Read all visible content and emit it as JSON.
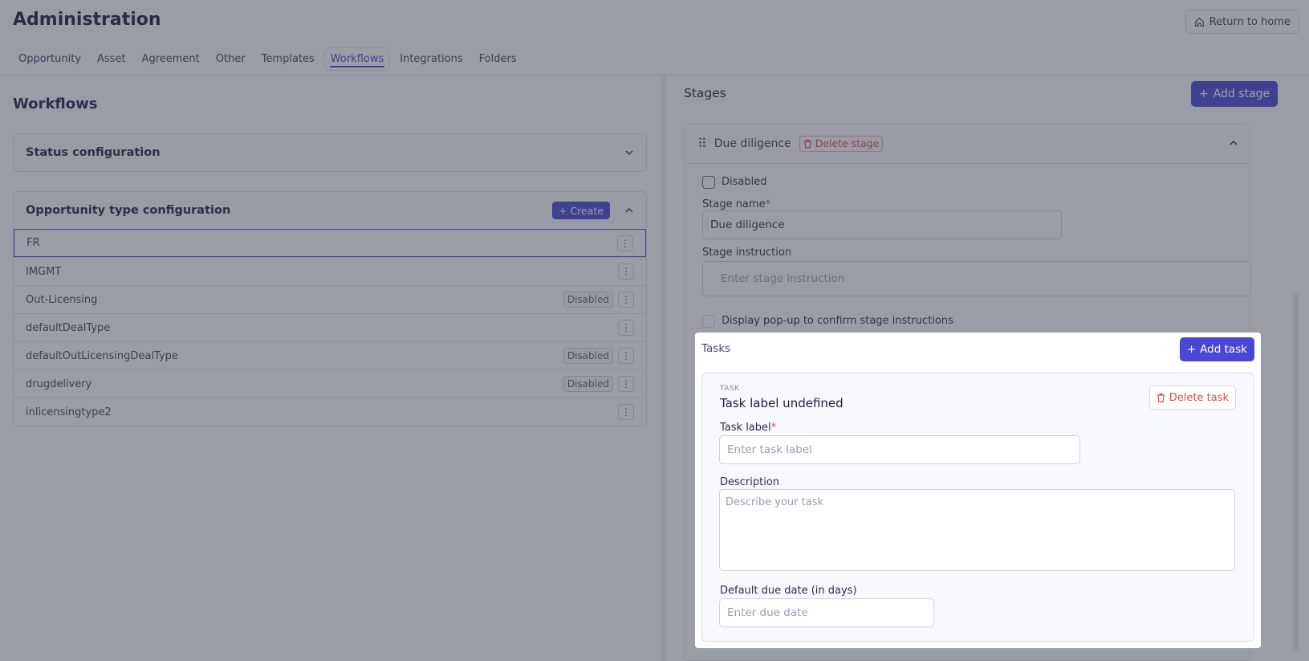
{
  "header": {
    "title": "Administration",
    "return_label": "Return to home",
    "tabs": [
      {
        "label": "Opportunity"
      },
      {
        "label": "Asset"
      },
      {
        "label": "Agreement"
      },
      {
        "label": "Other"
      },
      {
        "label": "Templates"
      },
      {
        "label": "Workflows",
        "active": true
      },
      {
        "label": "Integrations"
      },
      {
        "label": "Folders"
      }
    ]
  },
  "workflows": {
    "title": "Workflows",
    "status_config": {
      "title": "Status configuration"
    },
    "opp_config": {
      "title": "Opportunity type configuration",
      "create_label": "Create",
      "rows": [
        {
          "name": "FR",
          "badge": ""
        },
        {
          "name": "IMGMT",
          "badge": ""
        },
        {
          "name": "Out-Licensing",
          "badge": "Disabled"
        },
        {
          "name": "defaultDealType",
          "badge": ""
        },
        {
          "name": "defaultOutLicensingDealType",
          "badge": "Disabled"
        },
        {
          "name": "drugdelivery",
          "badge": "Disabled"
        },
        {
          "name": "inlicensingtype2",
          "badge": ""
        }
      ]
    }
  },
  "stages": {
    "title": "Stages",
    "add_stage_label": "Add stage",
    "stage": {
      "name": "Due diligence",
      "delete_label": "Delete stage",
      "disabled_label": "Disabled",
      "stage_name_label": "Stage name",
      "stage_name_value": "Due diligence",
      "instruction_label": "Stage instruction",
      "instruction_placeholder": "Enter stage instruction",
      "popup_label": "Display pop-up to confirm stage instructions"
    }
  },
  "tasks": {
    "title": "Tasks",
    "add_task_label": "Add task",
    "task": {
      "kicker": "TASK",
      "title": "Task label undefined",
      "delete_label": "Delete task",
      "label_label": "Task label",
      "label_placeholder": "Enter task label",
      "description_label": "Description",
      "description_placeholder": "Describe your task",
      "due_label": "Default due date (in days)",
      "due_placeholder": "Enter due date"
    }
  },
  "colors": {
    "accent": "#4b47d6",
    "danger": "#d94c4c",
    "overlay": "#373c4e"
  }
}
